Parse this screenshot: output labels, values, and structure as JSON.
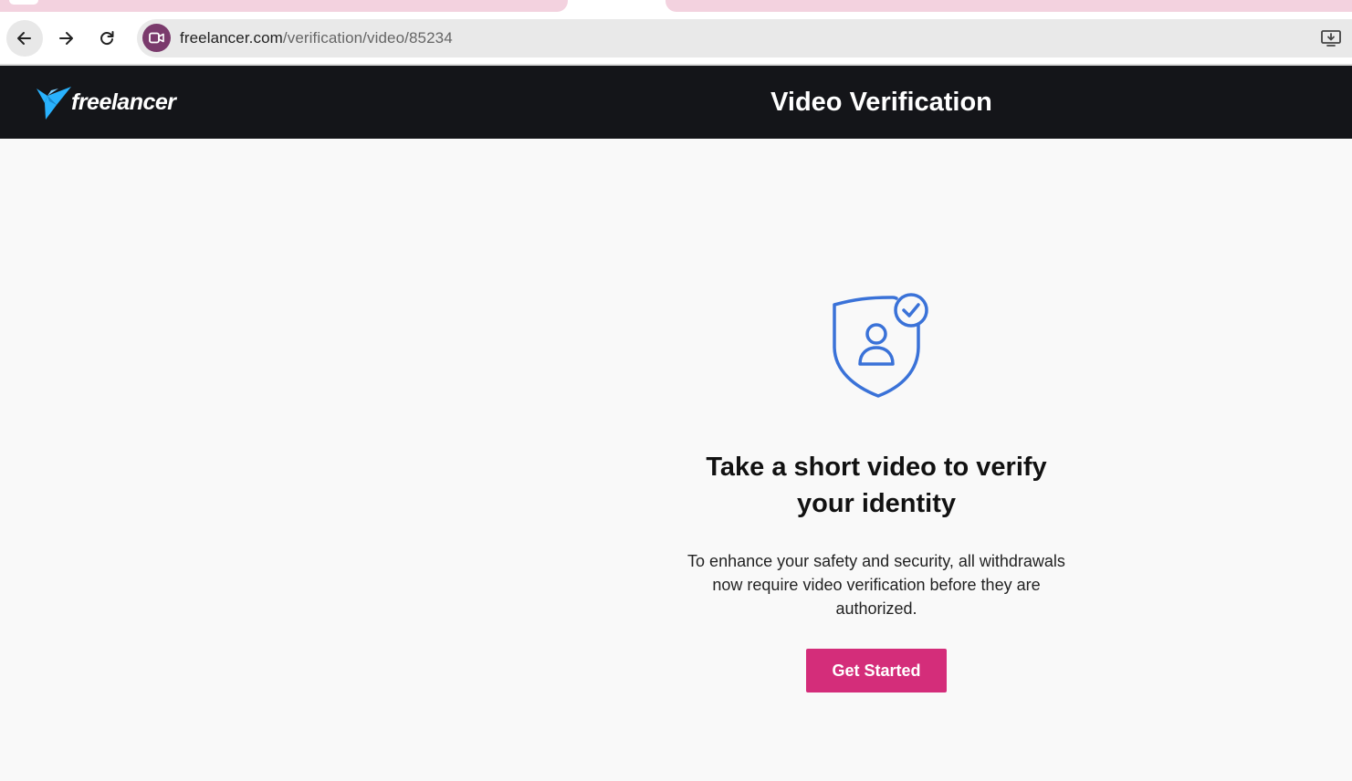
{
  "browser": {
    "url_domain": "freelancer.com",
    "url_path": "/verification/video/85234"
  },
  "site": {
    "logo_text": "freelancer",
    "page_title": "Video Verification"
  },
  "verification": {
    "headline": "Take a short video to verify your identity",
    "description": "To enhance your safety and security, all withdrawals now require video verification before they are authorized.",
    "cta_label": "Get Started"
  },
  "colors": {
    "header_bg": "#141519",
    "accent": "#d42d7a",
    "icon_blue": "#3a72d8",
    "logo_blue": "#29b2fe"
  },
  "icons": {
    "back": "arrow-left-icon",
    "forward": "arrow-right-icon",
    "reload": "reload-icon",
    "site": "video-camera-icon",
    "install": "install-app-icon",
    "logo": "freelancer-bird-icon",
    "hero": "shield-user-check-icon"
  }
}
